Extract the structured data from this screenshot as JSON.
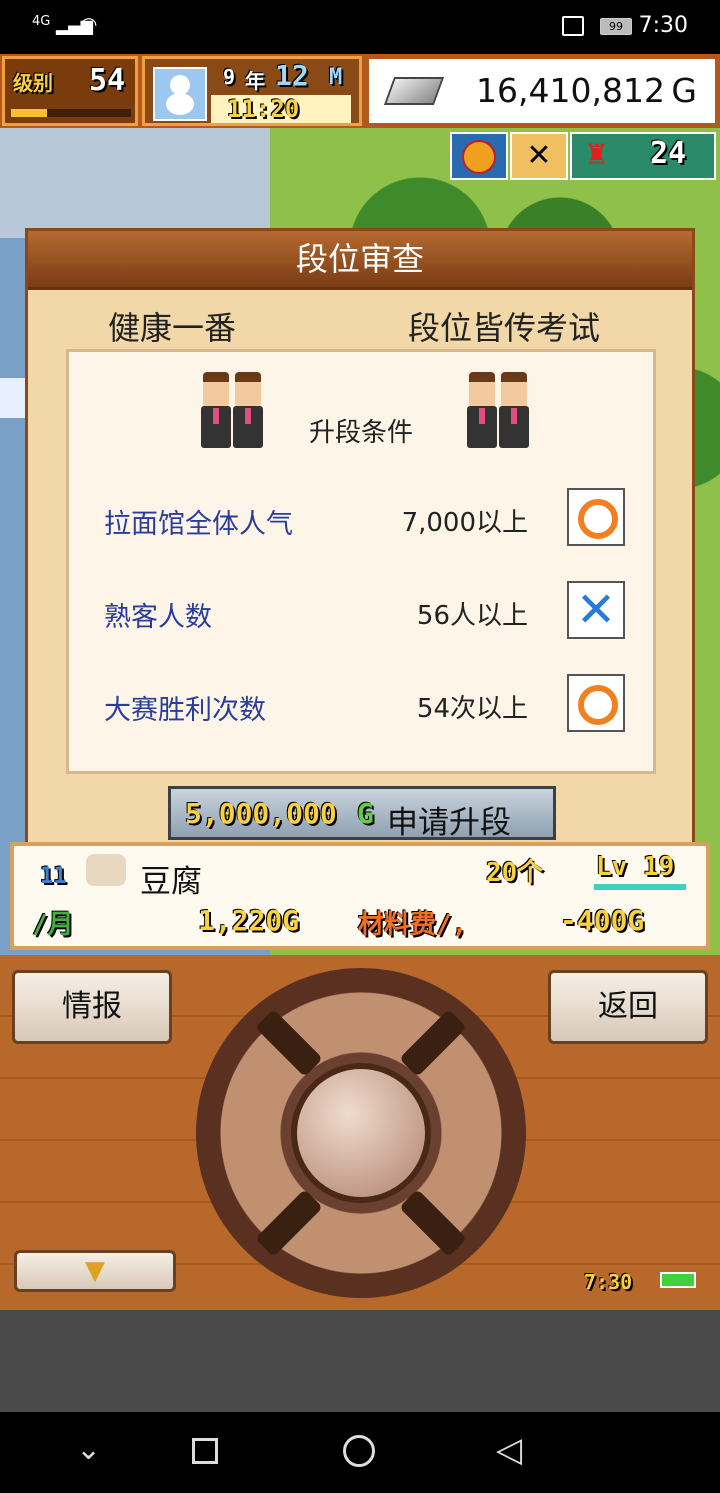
{
  "status_bar": {
    "network": "4G",
    "battery": "99",
    "time": "7:30"
  },
  "hud": {
    "level_label": "级别",
    "level_value": "54",
    "year": "9",
    "year_label": "年",
    "month": "12",
    "month_label": "M",
    "clock": "11:20",
    "money": "16,410,812",
    "money_unit": "G",
    "visitors": "24"
  },
  "dialog": {
    "title": "段位审查",
    "rank_current": "健康一番",
    "rank_next": "段位皆传考试",
    "conditions_header": "升段条件",
    "conditions": [
      {
        "label": "拉面馆全体人气",
        "requirement": "7,000以上",
        "met": true
      },
      {
        "label": "熟客人数",
        "requirement": "56人以上",
        "met": false
      },
      {
        "label": "大赛胜利次数",
        "requirement": "54次以上",
        "met": true
      }
    ],
    "apply": {
      "cost": "5,000,000",
      "cost_unit": "G",
      "label": "申请升段"
    }
  },
  "item_bar": {
    "item_name": "豆腐",
    "count": "20个",
    "level": "Lv 19",
    "date_day": "11",
    "date_month": "/月",
    "price": "1,220G",
    "material_label": "材料费/,",
    "material_cost": "-400G"
  },
  "controls": {
    "info_label": "情报",
    "back_label": "返回",
    "game_time": "7:30"
  },
  "colors": {
    "condition_text": "#2a3c9c",
    "ok_ring": "#f08020",
    "ng_cross": "#2a7ad8"
  }
}
